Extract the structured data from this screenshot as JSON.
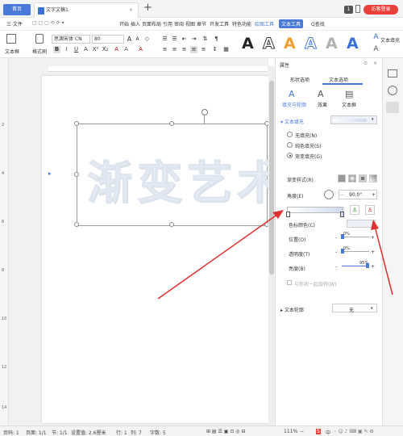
{
  "titlebar": {
    "home_tab": "首页",
    "doc_tab": "文字文稿1",
    "plus": "+",
    "badge": "1",
    "login": "访客登录"
  },
  "menubar": {
    "file": "三 文件",
    "items": [
      "开始",
      "插入",
      "页面布局",
      "引用",
      "审阅",
      "视图",
      "章节",
      "开发工具",
      "特色功能",
      "绘图工具",
      "文本工具"
    ],
    "search": "Q查找"
  },
  "toolbar": {
    "textbox": "文本框",
    "format_brush": "格式刷",
    "font": "思源宋体 CN",
    "size": "80",
    "wordart_letter": "A",
    "fill_label": "文本填充"
  },
  "document": {
    "art_text": "渐变艺术"
  },
  "panel": {
    "title": "属性",
    "tabs": [
      "形状选项",
      "文本选项"
    ],
    "subtabs": [
      "填充与轮廓",
      "效果",
      "文本框"
    ],
    "text_fill": "文本填充",
    "no_fill": "无填充(N)",
    "solid_fill": "纯色填充(S)",
    "gradient_fill": "渐变填充(G)",
    "gradient_style": "渐变样式(R)",
    "angle_label": "角度(E)",
    "angle_value": "90.0°",
    "stop_color": "色标颜色(C)",
    "position": "位置(O)",
    "position_value": "0%",
    "transparency": "透明度(T)",
    "transparency_value": "0%",
    "brightness": "亮度(B)",
    "brightness_value": "95%",
    "rotate_with_shape": "与形状一起旋转(W)",
    "text_outline": "文本轮廓",
    "outline_value": "无",
    "minus": "-",
    "plus": "+"
  },
  "statusbar": {
    "page_num": "页码: 1",
    "page": "页面: 1/1",
    "section": "节: 1/1",
    "settings": "设置值: 2.6厘米",
    "row": "行: 1",
    "col": "列: 7",
    "words": "字数: 5",
    "zoom": "111%",
    "ime": "中"
  },
  "colors": {
    "accent": "#4a79d8",
    "login": "#e8413b",
    "arrow": "#e03030"
  }
}
